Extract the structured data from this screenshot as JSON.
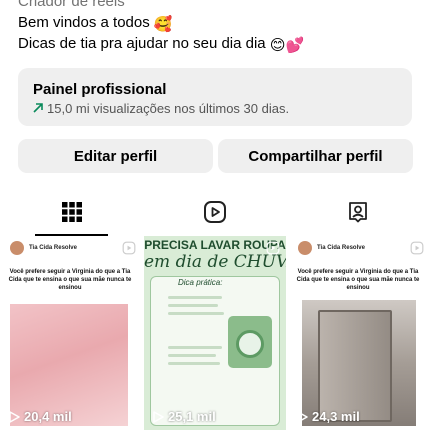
{
  "profile": {
    "category": "Criador de reels",
    "bio": [
      {
        "text": "Bem vindos a todos",
        "emoji": "🥰"
      },
      {
        "text": "Dicas de tia pra ajudar no seu dia dia",
        "emoji": "😊💕"
      }
    ]
  },
  "pro_panel": {
    "title": "Painel profissional",
    "stats": "15,0 mi visualizações nos últimos 30 dias."
  },
  "actions": {
    "edit_label": "Editar perfil",
    "share_label": "Compartilhar perfil"
  },
  "tabs": [
    {
      "name": "grid",
      "icon": "grid-icon",
      "active": true
    },
    {
      "name": "reels",
      "icon": "reels-icon",
      "active": false
    },
    {
      "name": "tagged",
      "icon": "tagged-icon",
      "active": false
    }
  ],
  "posts": [
    {
      "account": "Tia Cida Resolve",
      "caption": "Você prefere seguir a Virginia do que a Tia Cida que te ensina o que sua mãe nunca te ensinou",
      "views": "20,4 mil"
    },
    {
      "title": "PRECISA LAVAR ROUPA",
      "subtitle": "em dia de CHUVA?",
      "tip_label": "Dica prática:",
      "views": "25,1 mil"
    },
    {
      "account": "Tia Cida Resolve",
      "caption": "Você prefere seguir a Virginia do que a Tia Cida que te ensina o que sua mãe nunca te ensinou",
      "views": "24,3 mil"
    }
  ],
  "colors": {
    "accent_green": "#0a8a5b",
    "button_bg": "#efefef"
  }
}
